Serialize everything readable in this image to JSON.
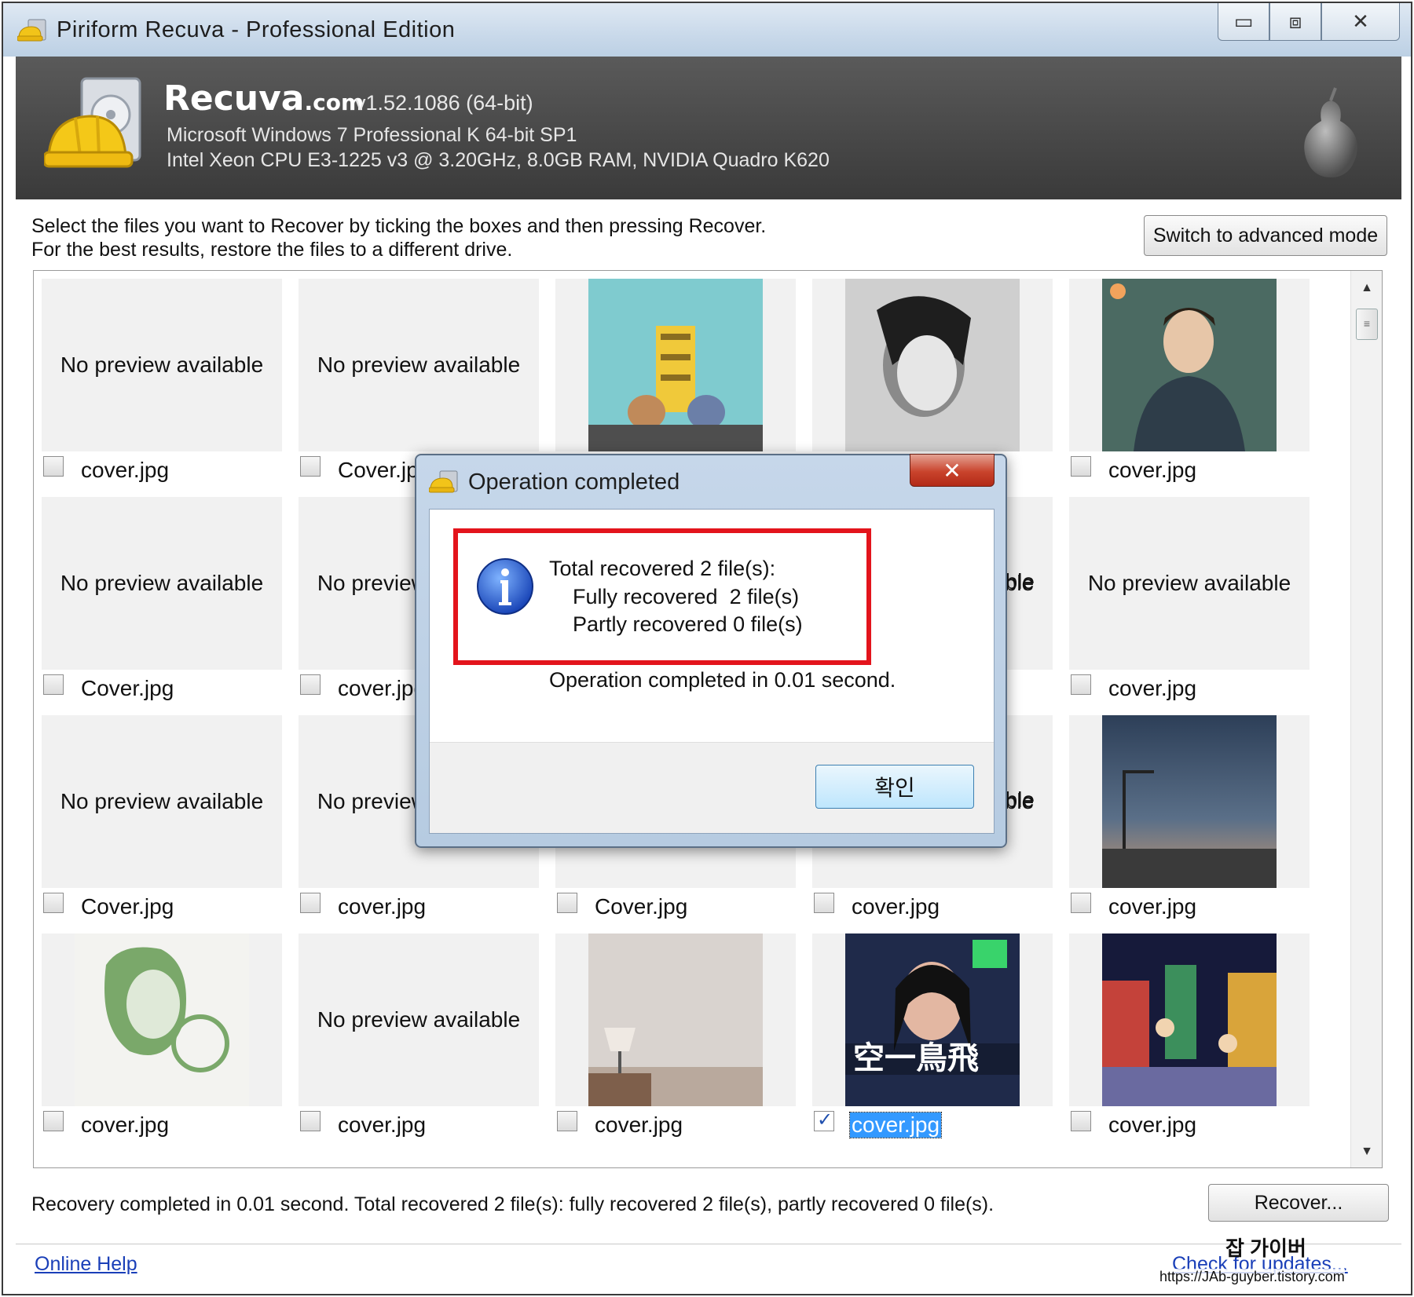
{
  "window": {
    "title": "Piriform Recuva - Professional Edition",
    "min_glyph": "▭",
    "restore_glyph": "⧈",
    "close_glyph": "✕"
  },
  "header": {
    "brand": "Recuva",
    "brand_suffix": ".com",
    "version": "v1.52.1086 (64-bit)",
    "os_line": "Microsoft Windows 7 Professional K 64-bit SP1",
    "hw_line": "Intel Xeon CPU E3-1225 v3 @ 3.20GHz, 8.0GB RAM, NVIDIA Quadro K620"
  },
  "instructions": {
    "line1": "Select the files you want to Recover by ticking the boxes and then pressing Recover.",
    "line2": "For the best results, restore the files to a different drive.",
    "advanced_button": "Switch to advanced mode"
  },
  "no_preview_text": "No preview available",
  "files": [
    {
      "name": "cover.jpg",
      "preview": false,
      "checked": false,
      "selected": false
    },
    {
      "name": "Cover.jpg",
      "preview": false,
      "checked": false,
      "selected": false
    },
    {
      "name": "",
      "preview": true,
      "art": "teal",
      "checked": false,
      "selected": false
    },
    {
      "name": "",
      "preview": true,
      "art": "bw",
      "checked": false,
      "selected": false
    },
    {
      "name": "cover.jpg",
      "preview": true,
      "art": "man",
      "checked": false,
      "selected": false
    },
    {
      "name": "Cover.jpg",
      "preview": false,
      "checked": false,
      "selected": false
    },
    {
      "name": "cover.jpg",
      "preview": false,
      "checked": false,
      "selected": false
    },
    {
      "name": "",
      "preview": false,
      "checked": false,
      "selected": false,
      "hidden": true
    },
    {
      "name": "",
      "preview": false,
      "checked": false,
      "selected": false,
      "hidden": true
    },
    {
      "name": "cover.jpg",
      "preview": false,
      "checked": false,
      "selected": false
    },
    {
      "name": "Cover.jpg",
      "preview": false,
      "checked": false,
      "selected": false
    },
    {
      "name": "cover.jpg",
      "preview": false,
      "checked": false,
      "selected": false
    },
    {
      "name": "Cover.jpg",
      "preview": false,
      "checked": false,
      "selected": false,
      "hidden": true
    },
    {
      "name": "cover.jpg",
      "preview": false,
      "checked": false,
      "selected": false,
      "hidden": true
    },
    {
      "name": "cover.jpg",
      "preview": true,
      "art": "night",
      "checked": false,
      "selected": false
    },
    {
      "name": "cover.jpg",
      "preview": true,
      "art": "green",
      "checked": false,
      "selected": false
    },
    {
      "name": "cover.jpg",
      "preview": false,
      "checked": false,
      "selected": false
    },
    {
      "name": "cover.jpg",
      "preview": true,
      "art": "room",
      "checked": false,
      "selected": false
    },
    {
      "name": "cover.jpg",
      "preview": true,
      "art": "blue",
      "checked": true,
      "selected": true
    },
    {
      "name": "cover.jpg",
      "preview": true,
      "art": "city",
      "checked": false,
      "selected": false
    }
  ],
  "partial_labels": {
    "row2_col4": "able",
    "row3_col4": "able"
  },
  "status": {
    "text": "Recovery completed in 0.01 second. Total recovered 2 file(s): fully recovered 2 file(s), partly recovered 0 file(s).",
    "recover_button": "Recover...",
    "online_help": "Online Help",
    "check_updates": "Check for updates..."
  },
  "watermark": {
    "title": "잡 가이버",
    "url": "https://JAb-guyber.tistory.com"
  },
  "dialog": {
    "title": "Operation completed",
    "close_glyph": "✕",
    "line1": "Total recovered 2 file(s):",
    "line2": "Fully recovered  2 file(s)",
    "line3": "Partly recovered 0 file(s)",
    "line4": "Operation completed in 0.01 second.",
    "ok_button": "확인"
  },
  "colors": {
    "highlight": "#e3141c",
    "selection": "#3399ff",
    "link": "#1a3fb8"
  }
}
